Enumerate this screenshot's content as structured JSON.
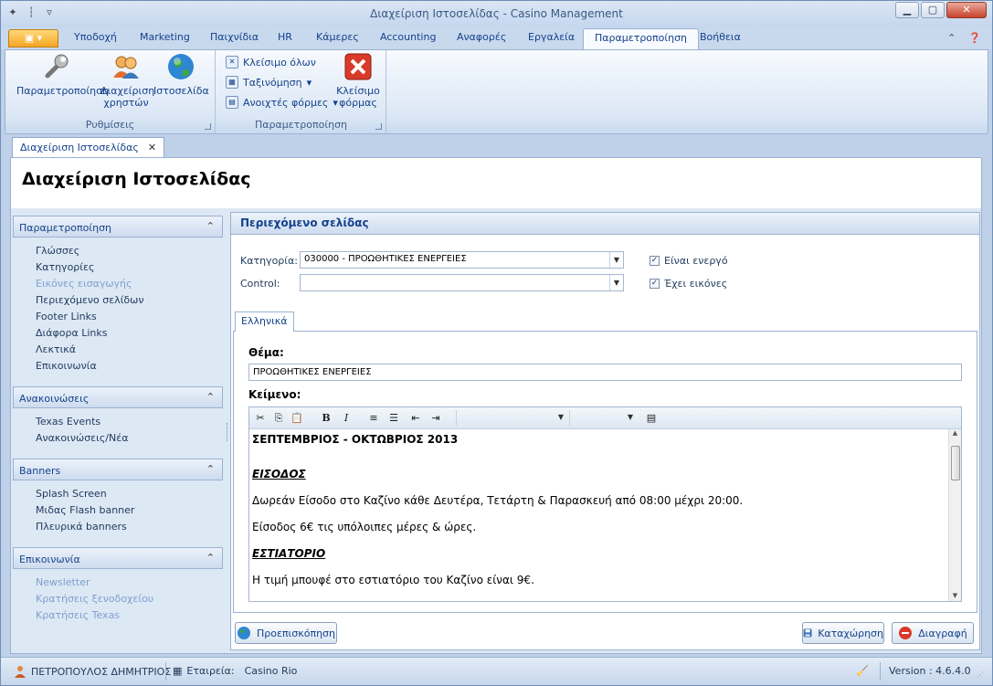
{
  "window": {
    "title": "Διαχείριση Ιστοσελίδας - Casino Management"
  },
  "ribbon_tabs": [
    "Υποδοχή",
    "Marketing",
    "Παιχνίδια",
    "HR",
    "Κάμερες",
    "Accounting",
    "Αναφορές",
    "Εργαλεία",
    "Παραμετροποίηση",
    "Βοήθεια"
  ],
  "active_ribbon_tab": "Παραμετροποίηση",
  "ribbon": {
    "group1": {
      "label": "Ρυθμίσεις",
      "buttons": [
        "Παραμετροποίηση",
        "Διαχείριση χρηστών",
        "Ιστοσελίδα"
      ]
    },
    "group2": {
      "label": "Παραμετροποίηση",
      "small_buttons": [
        "Κλείσιμο όλων",
        "Ταξινόμηση",
        "Ανοιχτές φόρμες"
      ],
      "close_form": "Κλείσιμο φόρμας"
    }
  },
  "doc_tab": {
    "label": "Διαχείριση Ιστοσελίδας",
    "close": "✕"
  },
  "page_title": "Διαχείριση Ιστοσελίδας",
  "nav": [
    {
      "header": "Παραμετροποίηση",
      "items": [
        {
          "label": "Γλώσσες",
          "enabled": true
        },
        {
          "label": "Κατηγορίες",
          "enabled": true
        },
        {
          "label": "Εικόνες εισαγωγής",
          "enabled": false
        },
        {
          "label": "Περιεχόμενο σελίδων",
          "enabled": true
        },
        {
          "label": "Footer Links",
          "enabled": true
        },
        {
          "label": "Διάφορα Links",
          "enabled": true
        },
        {
          "label": "Λεκτικά",
          "enabled": true
        },
        {
          "label": "Επικοινωνία",
          "enabled": true
        }
      ]
    },
    {
      "header": "Ανακοινώσεις",
      "items": [
        {
          "label": "Texas Events",
          "enabled": true
        },
        {
          "label": "Ανακοινώσεις/Νέα",
          "enabled": true
        }
      ]
    },
    {
      "header": "Banners",
      "items": [
        {
          "label": "Splash Screen",
          "enabled": true
        },
        {
          "label": "Μιδας Flash banner",
          "enabled": true
        },
        {
          "label": "Πλευρικά banners",
          "enabled": true
        }
      ]
    },
    {
      "header": "Επικοινωνία",
      "items": [
        {
          "label": "Newsletter",
          "enabled": false
        },
        {
          "label": "Κρατήσεις ξενοδοχείου",
          "enabled": false
        },
        {
          "label": "Κρατήσεις Texas",
          "enabled": false
        }
      ]
    }
  ],
  "panel": {
    "title": "Περιεχόμενο σελίδας",
    "category_label": "Κατηγορία:",
    "category_value": "030000 - ΠΡΟΩΘΗΤΙΚΕΣ ΕΝΕΡΓΕΙΕΣ",
    "control_label": "Control:",
    "control_value": "",
    "active_label": "Είναι ενεργό",
    "active_checked": true,
    "images_label": "Έχει εικόνες",
    "images_checked": true,
    "lang_tab": "Ελληνικά",
    "subject_label": "Θέμα:",
    "subject_value": "ΠΡΟΩΘΗΤΙΚΕΣ ΕΝΕΡΓΕΙΕΣ",
    "body_label": "Κείμενο:",
    "body": {
      "heading": "ΣΕΠΤΕΜΒΡΙΟΣ - ΟΚΤΩΒΡΙΟΣ 2013",
      "entry_title": "ΕΙΣΟΔΟΣ",
      "entry_line1": "Δωρεάν Είσοδο στο Καζίνο κάθε Δευτέρα, Τετάρτη & Παρασκευή από 08:00 μέχρι 20:00.",
      "entry_line2": "Είσοδος 6€ τις υπόλοιπες μέρες & ώρες.",
      "restaurant_title": "ΕΣΤΙΑΤΟΡΙΟ",
      "restaurant_line": "Η τιμή μπουφέ στο εστιατόριο του Καζίνο είναι 9€."
    }
  },
  "actions": {
    "preview": "Προεπισκόπηση",
    "save": "Καταχώρηση",
    "delete": "Διαγραφή"
  },
  "status": {
    "user": "ΠΕΤΡΟΠΟΥΛΟΣ ΔΗΜΗΤΡΙΟΣ",
    "company_label": "Εταιρεία:",
    "company": "Casino Rio",
    "version": "Version : 4.6.4.0"
  },
  "colors": {
    "accent": "#f5a623",
    "panel_bg": "#dde8f5",
    "header_text": "#15428b"
  }
}
